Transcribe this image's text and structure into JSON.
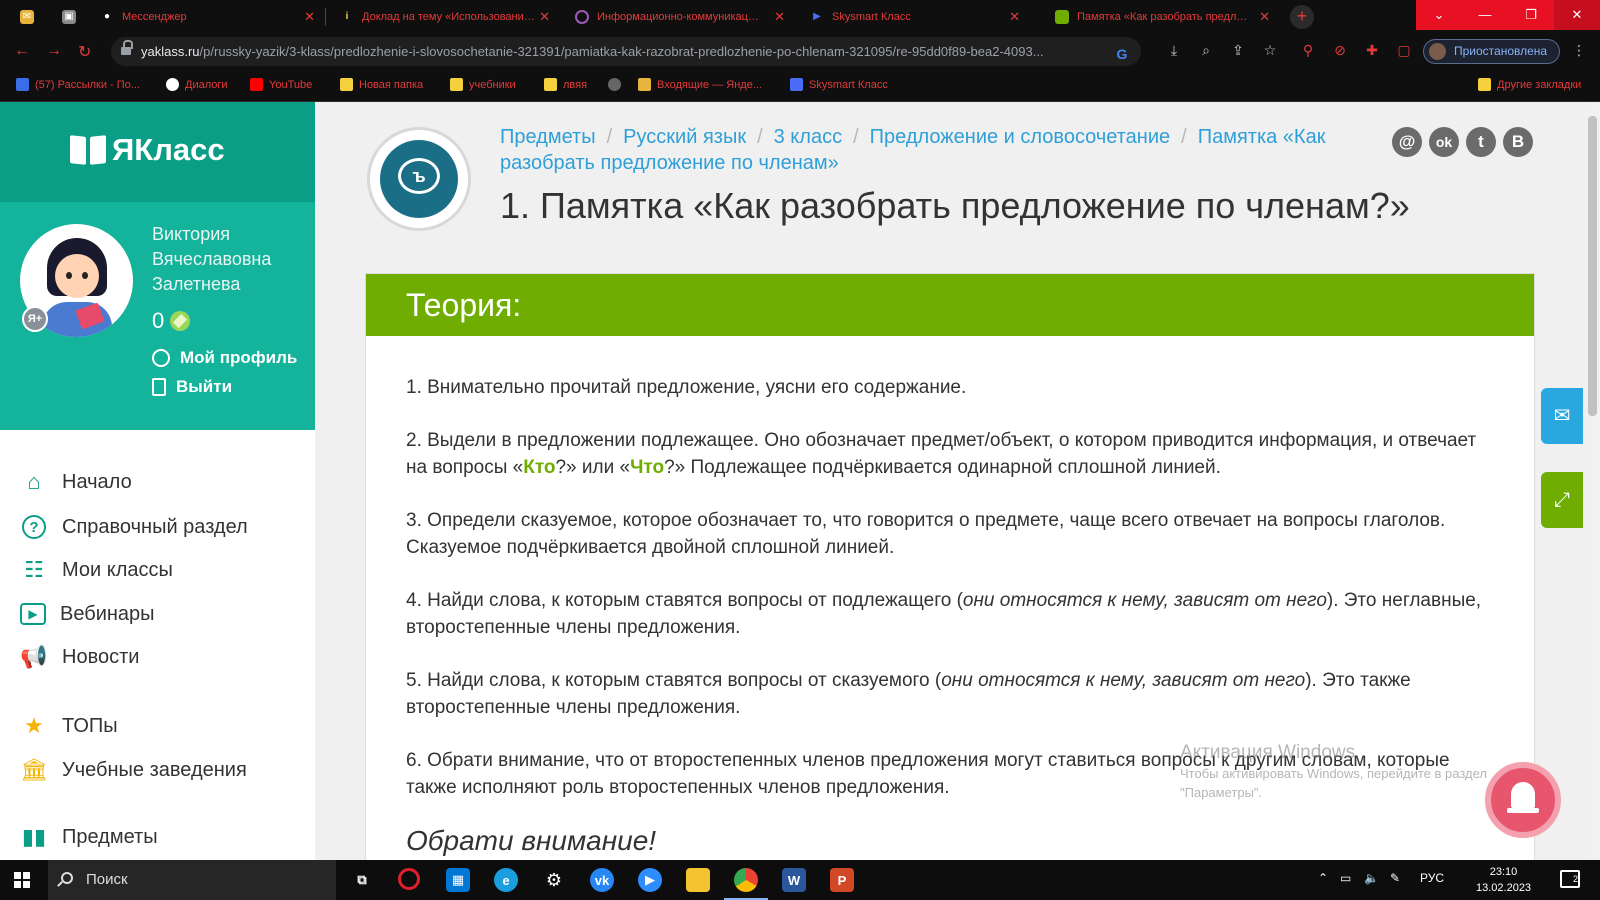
{
  "browser": {
    "tabs": [
      {
        "label": "",
        "icon": "mail-icon",
        "color": "#e8b33c"
      },
      {
        "label": "",
        "icon": "photo-icon",
        "color": "#8a8a8a"
      },
      {
        "label": "Мессенджер",
        "icon": "messenger-icon",
        "color": "#ffffff"
      },
      {
        "label": "Доклад на тему «Использовани…",
        "icon": "info-icon",
        "color": "#f4d03f"
      },
      {
        "label": "Информационно-коммуникац…",
        "icon": "circle-icon",
        "color": "#9b59b6"
      },
      {
        "label": "Skysmart Класс",
        "icon": "play-icon",
        "color": "#4a6cf7"
      },
      {
        "label": "Памятка «Как разобрать предл…",
        "icon": "book-icon",
        "color": "#6fad00"
      }
    ],
    "new_tab": "+",
    "window_controls": [
      "⌄",
      "—",
      "❐",
      "✕"
    ],
    "url_host": "yaklass.ru",
    "url_path": "/p/russky-yazik/3-klass/predlozhenie-i-slovosochetanie-321391/pamiatka-kak-razobrat-predlozhenie-po-chlenam-321095/re-95dd0f89-bea2-4093...",
    "profile_status": "Приостановлена",
    "bookmarks": [
      {
        "label": "(57) Рассылки - По...",
        "icon": "mail-icon"
      },
      {
        "label": "Диалоги",
        "icon": "chat-icon"
      },
      {
        "label": "YouTube",
        "icon": "youtube-icon"
      },
      {
        "label": "Новая папка",
        "icon": "folder-icon"
      },
      {
        "label": "учебники",
        "icon": "folder-icon"
      },
      {
        "label": "лвяя",
        "icon": "folder-icon"
      },
      {
        "label": "",
        "icon": "globe-icon"
      },
      {
        "label": "Входящие — Янде...",
        "icon": "mail-icon"
      },
      {
        "label": "Skysmart Класс",
        "icon": "play-icon"
      }
    ],
    "other_bookmarks": "Другие закладки"
  },
  "sidebar": {
    "logo": "ЯКласс",
    "user_name": "Виктория Вячеславовна Залетнева",
    "points": "0",
    "badge": "Я+",
    "my_profile": "Мой профиль",
    "logout": "Выйти",
    "menu": [
      {
        "label": "Начало",
        "icon": "home-icon"
      },
      {
        "label": "Справочный раздел",
        "icon": "help-icon"
      },
      {
        "label": "Мои классы",
        "icon": "classes-icon"
      },
      {
        "label": "Вебинары",
        "icon": "webinar-icon"
      },
      {
        "label": "Новости",
        "icon": "news-icon"
      },
      {
        "label": "ТОПы",
        "icon": "star-icon"
      },
      {
        "label": "Учебные заведения",
        "icon": "institution-icon"
      },
      {
        "label": "Предметы",
        "icon": "subjects-icon"
      }
    ]
  },
  "main": {
    "breadcrumbs": [
      "Предметы",
      "Русский язык",
      "3 класс",
      "Предложение и словосочетание",
      "Памятка «Как разобрать предложение по членам»"
    ],
    "title": "1. Памятка «Как разобрать предложение по членам?»",
    "social": [
      "@",
      "ok",
      "t",
      "В"
    ],
    "theory_header": "Теория:",
    "p1": "1. Внимательно прочитай предложение, уясни его содержание.",
    "p2_a": "2. Выдели в предложении подлежащее. Оно обозначает предмет/объект, о котором приводится информация, и отвечает на вопросы «",
    "p2_kto": "Кто",
    "p2_b": "?» или «",
    "p2_chto": "Что",
    "p2_c": "?» Подлежащее подчёркивается одинарной сплошной линией.",
    "p3": "3. Определи сказуемое, которое обозначает то, что говорится о предмете, чаще всего отвечает на вопросы глаголов. Сказуемое подчёркивается двойной сплошной линией.",
    "p4_a": "4. Найди слова, к которым ставятся вопросы от подлежащего (",
    "p4_i": "они относятся к нему,  зависят от него",
    "p4_b": "). Это неглавные, второстепенные члены предложения.",
    "p5_a": "5. Найди слова, к которым ставятся вопросы от сказуемого (",
    "p5_i": "они относятся к нему,  зависят от него",
    "p5_b": "). Это также второстепенные члены предложения.",
    "p6": "6. Обрати внимание, что от второстепенных членов предложения могут ставиться вопросы к другим словам, которые также исполняют роль второстепенных членов предложения.",
    "next_heading": "Обрати внимание!"
  },
  "windows_activation": {
    "title": "Активация Windows",
    "text": "Чтобы активировать Windows, перейдите в раздел \"Параметры\"."
  },
  "taskbar": {
    "search": "Поиск",
    "lang": "РУС",
    "time": "23:10",
    "date": "13.02.2023",
    "notifications": "2"
  }
}
